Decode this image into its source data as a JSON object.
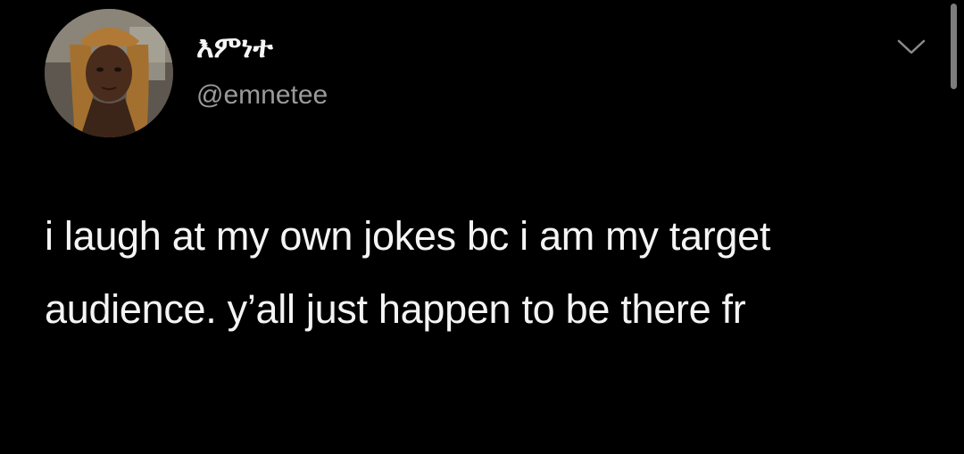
{
  "tweet": {
    "display_name": "እምነተ",
    "handle": "@emnetee",
    "text": "i laugh at my own jokes bc i am my target audience. y’all just happen to be there fr"
  },
  "icons": {
    "menu": "chevron-down-icon"
  },
  "colors": {
    "background": "#000000",
    "text": "#f4f4f4",
    "handle": "#9a9a9a"
  }
}
